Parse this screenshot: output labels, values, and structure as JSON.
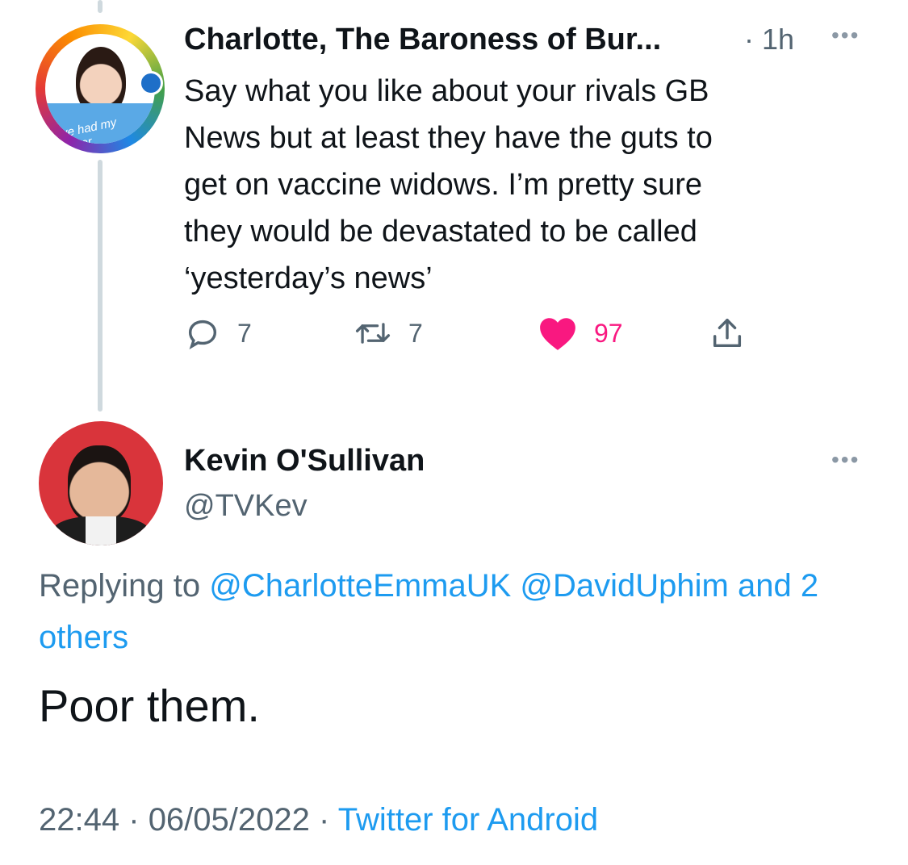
{
  "tweet1": {
    "author_name": "Charlotte, The Baroness of Bur...",
    "time": "· 1h",
    "more_label": "•••",
    "avatar_caption": "I've had my dinner",
    "text": "Say what you like about your rivals GB\nNews but at least they have the guts to\nget on vaccine widows.  I’m pretty sure\nthey would be devastated to be called\n‘yesterday’s news’",
    "replies": "7",
    "retweets": "7",
    "likes": "97",
    "like_color": "#f91880"
  },
  "tweet2": {
    "author_name": "Kevin O'Sullivan",
    "handle": "@TVKev",
    "more_label": "•••",
    "replying_prefix": "Replying to",
    "mention1": "@CharlotteEmmaUK",
    "mention2": "@DavidUphim",
    "replying_and": "and",
    "replying_others": "2 others",
    "text": "Poor them.",
    "time": "22:44",
    "date": "06/05/2022",
    "separator": "·",
    "source": "Twitter for Android",
    "link_color": "#1d9bf0"
  }
}
